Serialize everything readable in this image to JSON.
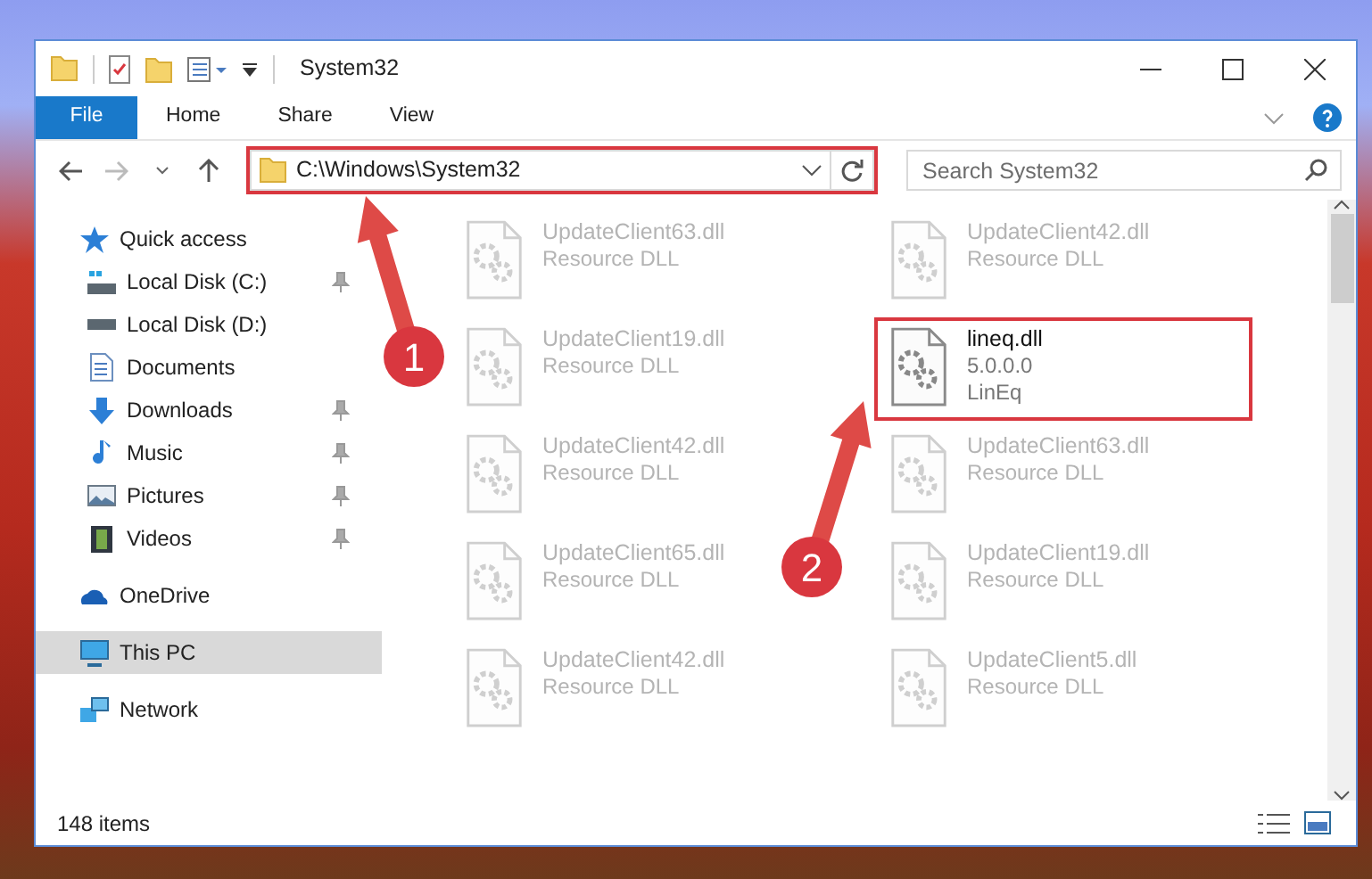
{
  "window": {
    "title": "System32"
  },
  "ribbon": {
    "tabs": [
      {
        "label": "File",
        "kind": "file",
        "selected": false
      },
      {
        "label": "Home",
        "kind": "tab",
        "selected": false
      },
      {
        "label": "Share",
        "kind": "tab",
        "selected": false
      },
      {
        "label": "View",
        "kind": "tab",
        "selected": false
      }
    ]
  },
  "address_bar": {
    "path": "C:\\Windows\\System32",
    "highlighted": true
  },
  "search": {
    "placeholder": "Search System32"
  },
  "navigation": [
    {
      "label": "Quick access",
      "selected": false,
      "children": [
        {
          "label": "Local Disk (C:)",
          "pinned": true,
          "selected": false
        },
        {
          "label": "Local Disk (D:)",
          "pinned": false,
          "selected": false
        },
        {
          "label": "Documents",
          "pinned": false,
          "selected": false
        },
        {
          "label": "Downloads",
          "pinned": true,
          "selected": false
        },
        {
          "label": "Music",
          "pinned": true,
          "selected": false
        },
        {
          "label": "Pictures",
          "pinned": true,
          "selected": false
        },
        {
          "label": "Videos",
          "pinned": true,
          "selected": false
        }
      ]
    },
    {
      "label": "OneDrive",
      "selected": false
    },
    {
      "label": "This PC",
      "selected": true
    },
    {
      "label": "Network",
      "selected": false
    }
  ],
  "files": [
    {
      "name": "UpdateClient63.dll",
      "details": [
        "Resource DLL"
      ],
      "faded": true,
      "highlighted": false
    },
    {
      "name": "UpdateClient42.dll",
      "details": [
        "Resource DLL"
      ],
      "faded": true,
      "highlighted": false
    },
    {
      "name": "UpdateClient19.dll",
      "details": [
        "Resource DLL"
      ],
      "faded": true,
      "highlighted": false
    },
    {
      "name": "lineq.dll",
      "details": [
        "5.0.0.0",
        "LinEq"
      ],
      "faded": false,
      "highlighted": true
    },
    {
      "name": "UpdateClient42.dll",
      "details": [
        "Resource DLL"
      ],
      "faded": true,
      "highlighted": false
    },
    {
      "name": "UpdateClient63.dll",
      "details": [
        "Resource DLL"
      ],
      "faded": true,
      "highlighted": false
    },
    {
      "name": "UpdateClient65.dll",
      "details": [
        "Resource DLL"
      ],
      "faded": true,
      "highlighted": false
    },
    {
      "name": "UpdateClient19.dll",
      "details": [
        "Resource DLL"
      ],
      "faded": true,
      "highlighted": false
    },
    {
      "name": "UpdateClient42.dll",
      "details": [
        "Resource DLL"
      ],
      "faded": true,
      "highlighted": false
    },
    {
      "name": "UpdateClient5.dll",
      "details": [
        "Resource DLL"
      ],
      "faded": true,
      "highlighted": false
    }
  ],
  "status_bar": {
    "item_count": "148 items"
  },
  "callouts": [
    {
      "number": "1"
    },
    {
      "number": "2"
    }
  ]
}
